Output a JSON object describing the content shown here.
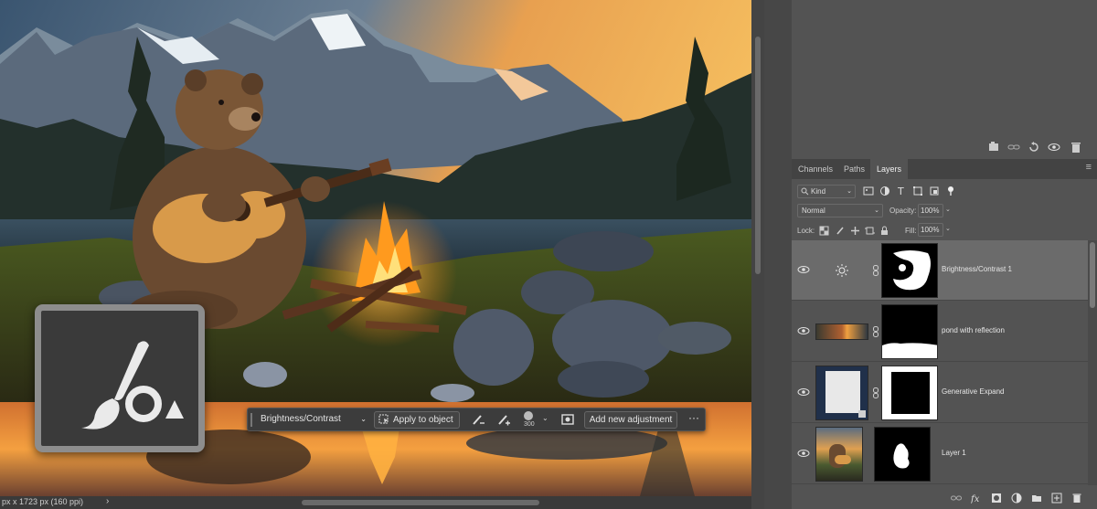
{
  "canvas": {
    "status_text": "px x 1723 px (160 ppi)",
    "status_arrow": "›"
  },
  "taskbar": {
    "adjustment_select": "Brightness/Contrast",
    "apply_button": "Apply to object",
    "brush_size": "300",
    "add_adjustment_button": "Add new adjustment",
    "more_button": "···"
  },
  "panel": {
    "tabs": [
      {
        "label": "Channels"
      },
      {
        "label": "Paths"
      },
      {
        "label": "Layers"
      }
    ],
    "active_tab": "Layers",
    "filter": {
      "kind_label": "Kind"
    },
    "blend_mode": "Normal",
    "opacity_label": "Opacity:",
    "opacity": "100%",
    "lock_label": "Lock:",
    "fill_label": "Fill:",
    "fill": "100%",
    "layers": [
      {
        "name": "Brightness/Contrast 1",
        "type": "adjustment",
        "selected": true
      },
      {
        "name": "pond with reflection",
        "type": "pixel",
        "selected": false
      },
      {
        "name": "Generative Expand",
        "type": "pixel",
        "selected": false
      },
      {
        "name": "Layer 1",
        "type": "pixel",
        "selected": false
      }
    ]
  },
  "colors": {
    "panel_bg": "#535353",
    "selected_layer": "#6b6b6b",
    "canvas_sky": "#f0a040",
    "fire": "#ff8a1a"
  },
  "icons": [
    "brush-tool-icon",
    "eye-icon",
    "link-icon",
    "trash-icon",
    "fx-icon",
    "mask-icon",
    "new-layer-icon",
    "folder-icon",
    "adjustment-icon",
    "sun-icon"
  ]
}
